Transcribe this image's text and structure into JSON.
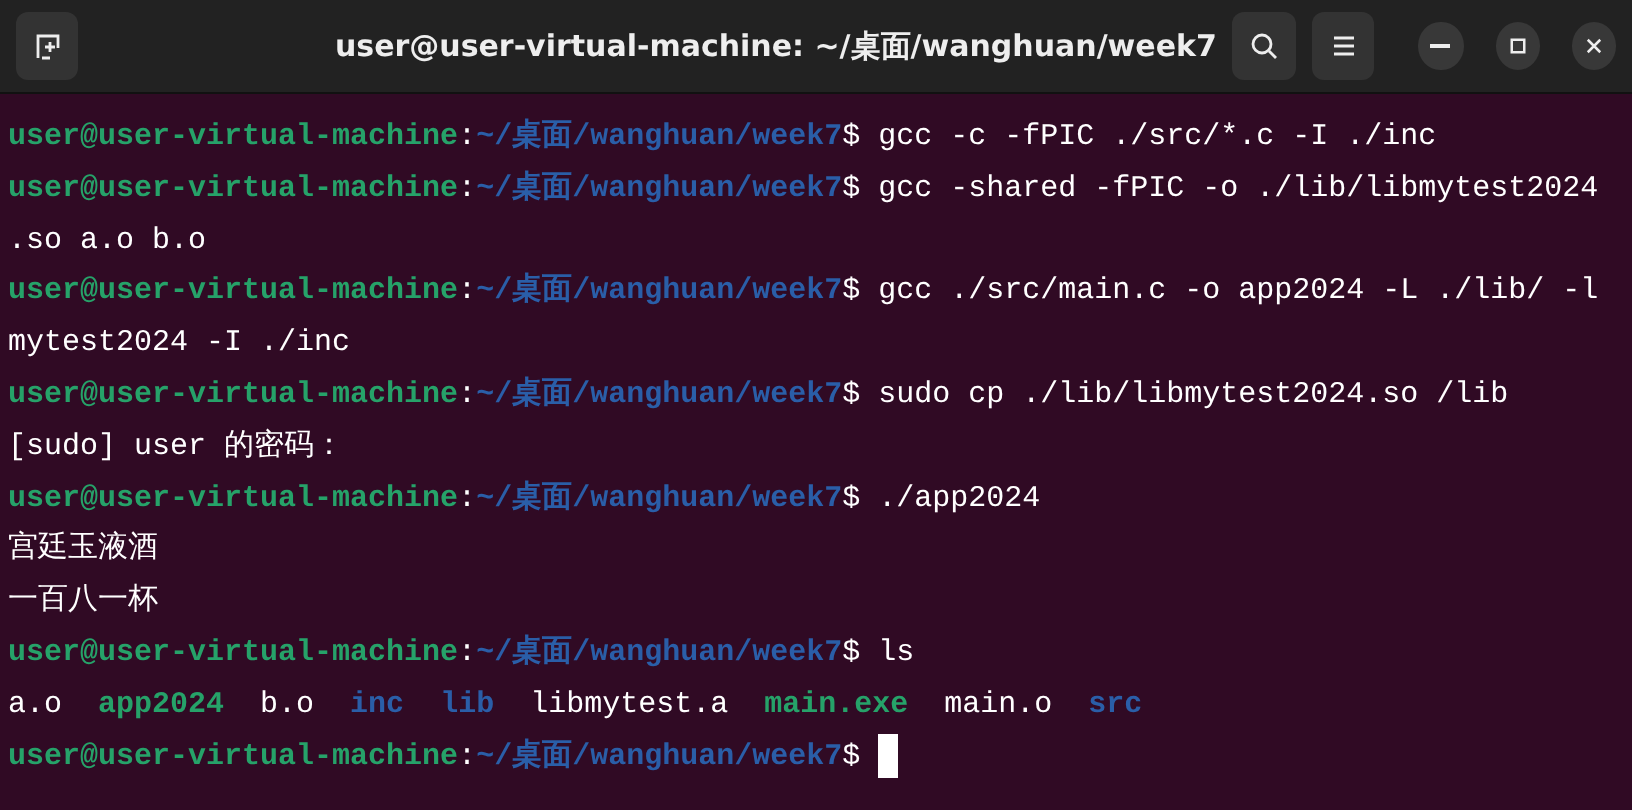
{
  "window": {
    "title": "user@user-virtual-machine: ~/桌面/wanghuan/week7"
  },
  "lines": [
    {
      "kind": "prompt",
      "user": "user@user-virtual-machine",
      "separator": ":",
      "path": "~/桌面/wanghuan/week7",
      "symbol": "$",
      "command": "gcc -c -fPIC ./src/*.c -I ./inc"
    },
    {
      "kind": "prompt",
      "user": "user@user-virtual-machine",
      "separator": ":",
      "path": "~/桌面/wanghuan/week7",
      "symbol": "$",
      "command": "gcc -shared -fPIC -o ./lib/libmytest2024"
    },
    {
      "kind": "output",
      "text": ".so a.o b.o"
    },
    {
      "kind": "prompt",
      "user": "user@user-virtual-machine",
      "separator": ":",
      "path": "~/桌面/wanghuan/week7",
      "symbol": "$",
      "command": "gcc ./src/main.c -o app2024 -L ./lib/ -l"
    },
    {
      "kind": "output",
      "text": "mytest2024 -I ./inc"
    },
    {
      "kind": "prompt",
      "user": "user@user-virtual-machine",
      "separator": ":",
      "path": "~/桌面/wanghuan/week7",
      "symbol": "$",
      "command": "sudo cp ./lib/libmytest2024.so /lib"
    },
    {
      "kind": "output",
      "text": "[sudo] user 的密码："
    },
    {
      "kind": "prompt",
      "user": "user@user-virtual-machine",
      "separator": ":",
      "path": "~/桌面/wanghuan/week7",
      "symbol": "$",
      "command": "./app2024"
    },
    {
      "kind": "output",
      "text": "宫廷玉液酒"
    },
    {
      "kind": "output",
      "text": "一百八一杯"
    },
    {
      "kind": "prompt",
      "user": "user@user-virtual-machine",
      "separator": ":",
      "path": "~/桌面/wanghuan/week7",
      "symbol": "$",
      "command": "ls"
    },
    {
      "kind": "listing",
      "entries": [
        {
          "name": "a.o",
          "kind": "file"
        },
        {
          "name": "app2024",
          "kind": "exec"
        },
        {
          "name": "b.o",
          "kind": "file"
        },
        {
          "name": "inc",
          "kind": "dir"
        },
        {
          "name": "lib",
          "kind": "dir"
        },
        {
          "name": "libmytest.a",
          "kind": "file"
        },
        {
          "name": "main.exe",
          "kind": "exec"
        },
        {
          "name": "main.o",
          "kind": "file"
        },
        {
          "name": "src",
          "kind": "dir"
        }
      ]
    },
    {
      "kind": "prompt",
      "user": "user@user-virtual-machine",
      "separator": ":",
      "path": "~/桌面/wanghuan/week7",
      "symbol": "$",
      "cursor": true
    }
  ]
}
